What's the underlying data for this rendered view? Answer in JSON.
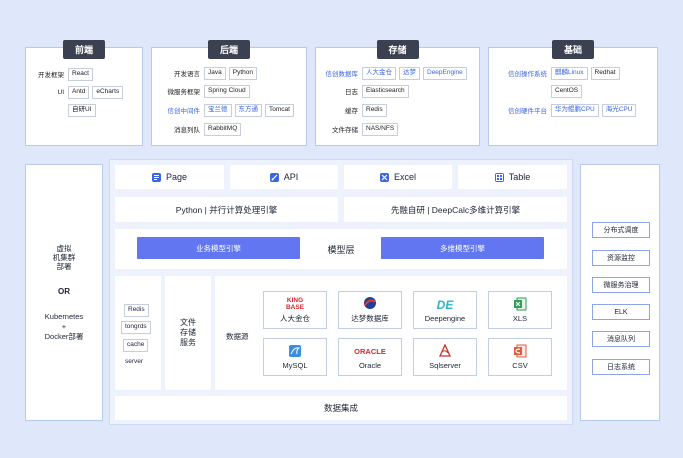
{
  "frontend": {
    "title": "前端",
    "rows": [
      {
        "label": "开发框架",
        "tags": [
          "React"
        ]
      },
      {
        "label": "UI",
        "tags": [
          "Antd",
          "eCharts"
        ]
      },
      {
        "label": "",
        "tags": [
          "自研UI"
        ]
      }
    ]
  },
  "backend": {
    "title": "后端",
    "rows": [
      {
        "label": "开发语言",
        "tags": [
          "Java",
          "Python"
        ]
      },
      {
        "label": "微服务框架",
        "tags": [
          "Spring Cloud"
        ]
      },
      {
        "label": "信创中间件",
        "tags": [
          "宝兰德",
          "东方通",
          "Tomcat"
        ]
      },
      {
        "label": "消息列队",
        "tags": [
          "RabbitMQ"
        ]
      }
    ]
  },
  "storage": {
    "title": "存储",
    "rows": [
      {
        "label": "信创数据库",
        "tags": [
          "人大金仓",
          "达梦",
          "DeepEngine"
        ]
      },
      {
        "label": "日志",
        "tags": [
          "Elasticsearch"
        ]
      },
      {
        "label": "缓存",
        "tags": [
          "Redis"
        ]
      },
      {
        "label": "文件存储",
        "tags": [
          "NAS/NFS"
        ]
      }
    ]
  },
  "infra": {
    "title": "基础",
    "rows": [
      {
        "label": "信创操作系统",
        "tags": [
          "麒麟Linux",
          "Redhat"
        ]
      },
      {
        "label": "",
        "tags": [
          "CentOS"
        ]
      },
      {
        "label": "信创硬件平台",
        "tags": [
          "华为鲲鹏CPU",
          "海光CPU"
        ]
      }
    ]
  },
  "deploy": {
    "line1": "虚拟",
    "line2": "机集群",
    "line3": "部署",
    "or": "OR",
    "line4": "Kubernetes",
    "line5": "+",
    "line6": "Docker部署"
  },
  "header_items": [
    {
      "label": "Page",
      "icon": "page-icon",
      "color": "#3a66e0"
    },
    {
      "label": "API",
      "icon": "api-icon",
      "color": "#3a66e0"
    },
    {
      "label": "Excel",
      "icon": "excel-icon",
      "color": "#3a66e0"
    },
    {
      "label": "Table",
      "icon": "table-icon",
      "color": "#3a66e0"
    }
  ],
  "compute": {
    "left": "Python | 并行计算处理引擎",
    "right": "先融自研 | DeepCalc多维计算引擎"
  },
  "model_layer": {
    "title": "模型层",
    "left_engine": "业务模型引擎",
    "right_engine": "多维模型引擎"
  },
  "cache_tags": [
    "Redis",
    "tongrds",
    "cache",
    "server"
  ],
  "file_service": {
    "l1": "文件",
    "l2": "存储",
    "l3": "服务"
  },
  "datasource": {
    "title": "数据源",
    "cards": [
      {
        "name": "人大金仓",
        "logo": "KING BASE",
        "icon": "kingbase-logo"
      },
      {
        "name": "达梦数据库",
        "logo": "",
        "icon": "dameng-logo"
      },
      {
        "name": "Deepengine",
        "logo": "DE",
        "icon": "deepengine-logo"
      },
      {
        "name": "XLS",
        "logo": "X",
        "icon": "xls-icon"
      },
      {
        "name": "MySQL",
        "logo": "",
        "icon": "mysql-icon"
      },
      {
        "name": "Oracle",
        "logo": "ORACLE",
        "icon": "oracle-logo"
      },
      {
        "name": "Sqlserver",
        "logo": "",
        "icon": "sqlserver-logo"
      },
      {
        "name": "CSV",
        "logo": "C",
        "icon": "csv-icon"
      }
    ]
  },
  "integration": "数据集成",
  "right_services": [
    "分布式调度",
    "资源监控",
    "微服务治理",
    "ELK",
    "消息队列",
    "日志系统"
  ],
  "colors": {
    "background": "#dfe7fb",
    "border": "#b9c8f0",
    "accent": "#6176f0",
    "tab": "#3b4150",
    "highlight_text": "#3a66e0"
  }
}
